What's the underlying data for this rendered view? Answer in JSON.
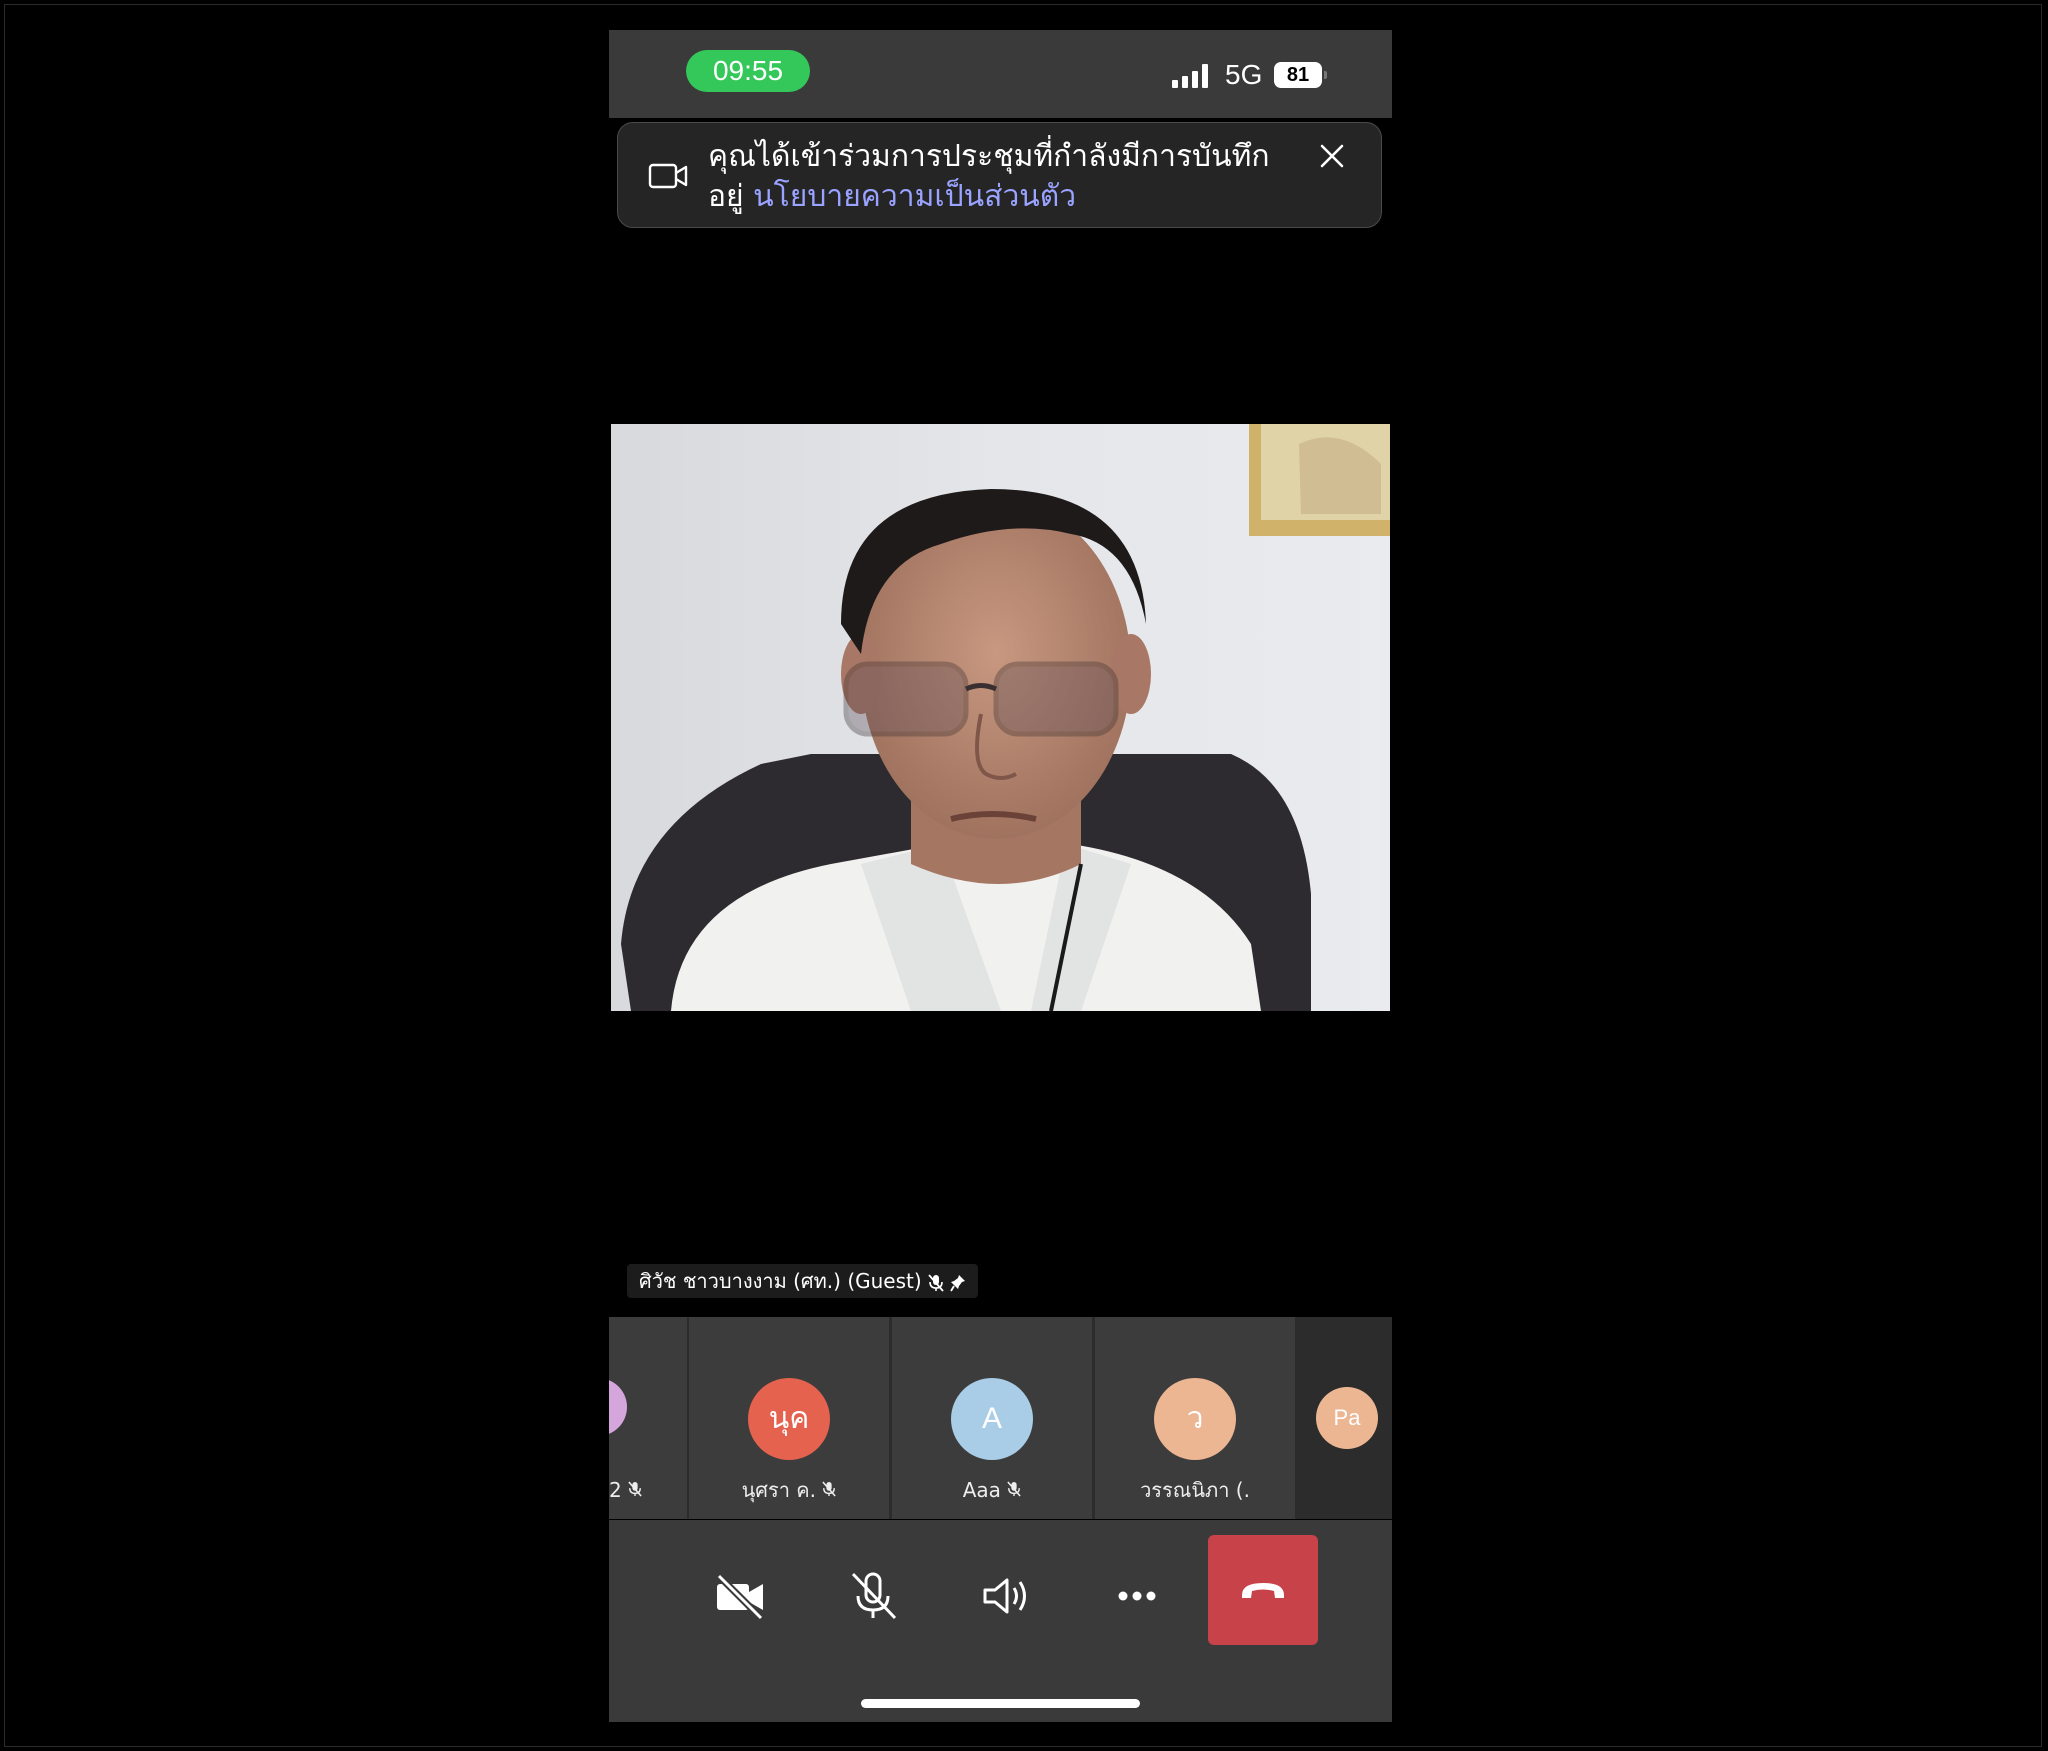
{
  "status_bar": {
    "time": "09:55",
    "network": "5G",
    "battery": "81",
    "colors": {
      "time_pill": "#34c759"
    }
  },
  "banner": {
    "message": "คุณได้เข้าร่วมการประชุมที่กำลังมีการบันทึกอยู่ ",
    "link": "นโยบายความเป็นส่วนตัว",
    "icons": [
      "video-camera-icon",
      "close-icon"
    ],
    "colors": {
      "link": "#9aa3ff"
    }
  },
  "main_video": {
    "participant_label": "ศิวัช ชาวบางงาม (ศท.) (Guest)",
    "icons": [
      "mic-muted-icon",
      "pin-icon"
    ]
  },
  "participants": [
    {
      "initials": "",
      "label": "2",
      "muted": true,
      "color": "#d5a6dc"
    },
    {
      "initials": "นุค",
      "label": "นุศรา ค.",
      "muted": true,
      "color": "#e4624e"
    },
    {
      "initials": "A",
      "label": "Aaa",
      "muted": true,
      "color": "#a9cde6"
    },
    {
      "initials": "ว",
      "label": "วรรณนิภา (.",
      "muted": false,
      "color": "#ecb693"
    },
    {
      "initials": "Pa",
      "label": "",
      "muted": false,
      "color": "#ecb693"
    }
  ],
  "controls": {
    "icons": [
      "camera-off-icon",
      "mic-off-icon",
      "speaker-icon",
      "more-icon",
      "end-call-icon"
    ],
    "colors": {
      "end_call": "#c8424a"
    }
  }
}
